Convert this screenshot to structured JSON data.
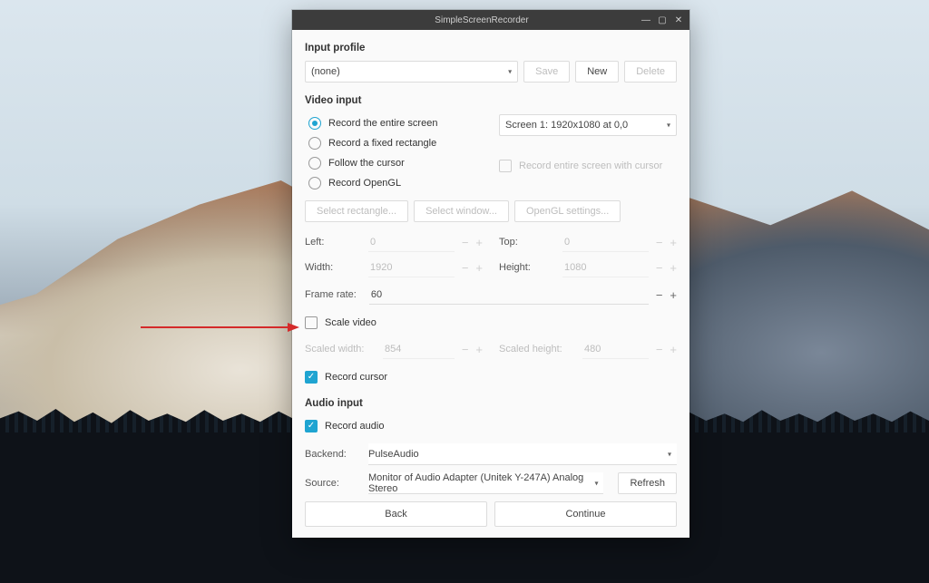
{
  "window": {
    "title": "SimpleScreenRecorder"
  },
  "input_profile": {
    "heading": "Input profile",
    "selected": "(none)",
    "buttons": {
      "save": "Save",
      "new": "New",
      "delete": "Delete"
    }
  },
  "video": {
    "heading": "Video input",
    "options": {
      "entire_screen": "Record the entire screen",
      "fixed_rect": "Record a fixed rectangle",
      "follow_cursor": "Follow the cursor",
      "opengl": "Record OpenGL",
      "entire_with_cursor": "Record entire screen with cursor"
    },
    "screen_selected": "Screen 1: 1920x1080 at 0,0",
    "buttons": {
      "select_rect": "Select rectangle...",
      "select_window": "Select window...",
      "opengl_settings": "OpenGL settings..."
    },
    "geom": {
      "left_label": "Left:",
      "left": "0",
      "top_label": "Top:",
      "top": "0",
      "width_label": "Width:",
      "width": "1920",
      "height_label": "Height:",
      "height": "1080"
    },
    "frame_rate_label": "Frame rate:",
    "frame_rate": "60",
    "scale_video": "Scale video",
    "scaled_width_label": "Scaled width:",
    "scaled_width": "854",
    "scaled_height_label": "Scaled height:",
    "scaled_height": "480",
    "record_cursor": "Record cursor"
  },
  "audio": {
    "heading": "Audio input",
    "record_audio": "Record audio",
    "backend_label": "Backend:",
    "backend": "PulseAudio",
    "source_label": "Source:",
    "source": "Monitor of Audio Adapter (Unitek Y-247A) Analog Stereo",
    "refresh": "Refresh"
  },
  "footer": {
    "back": "Back",
    "continue": "Continue"
  }
}
